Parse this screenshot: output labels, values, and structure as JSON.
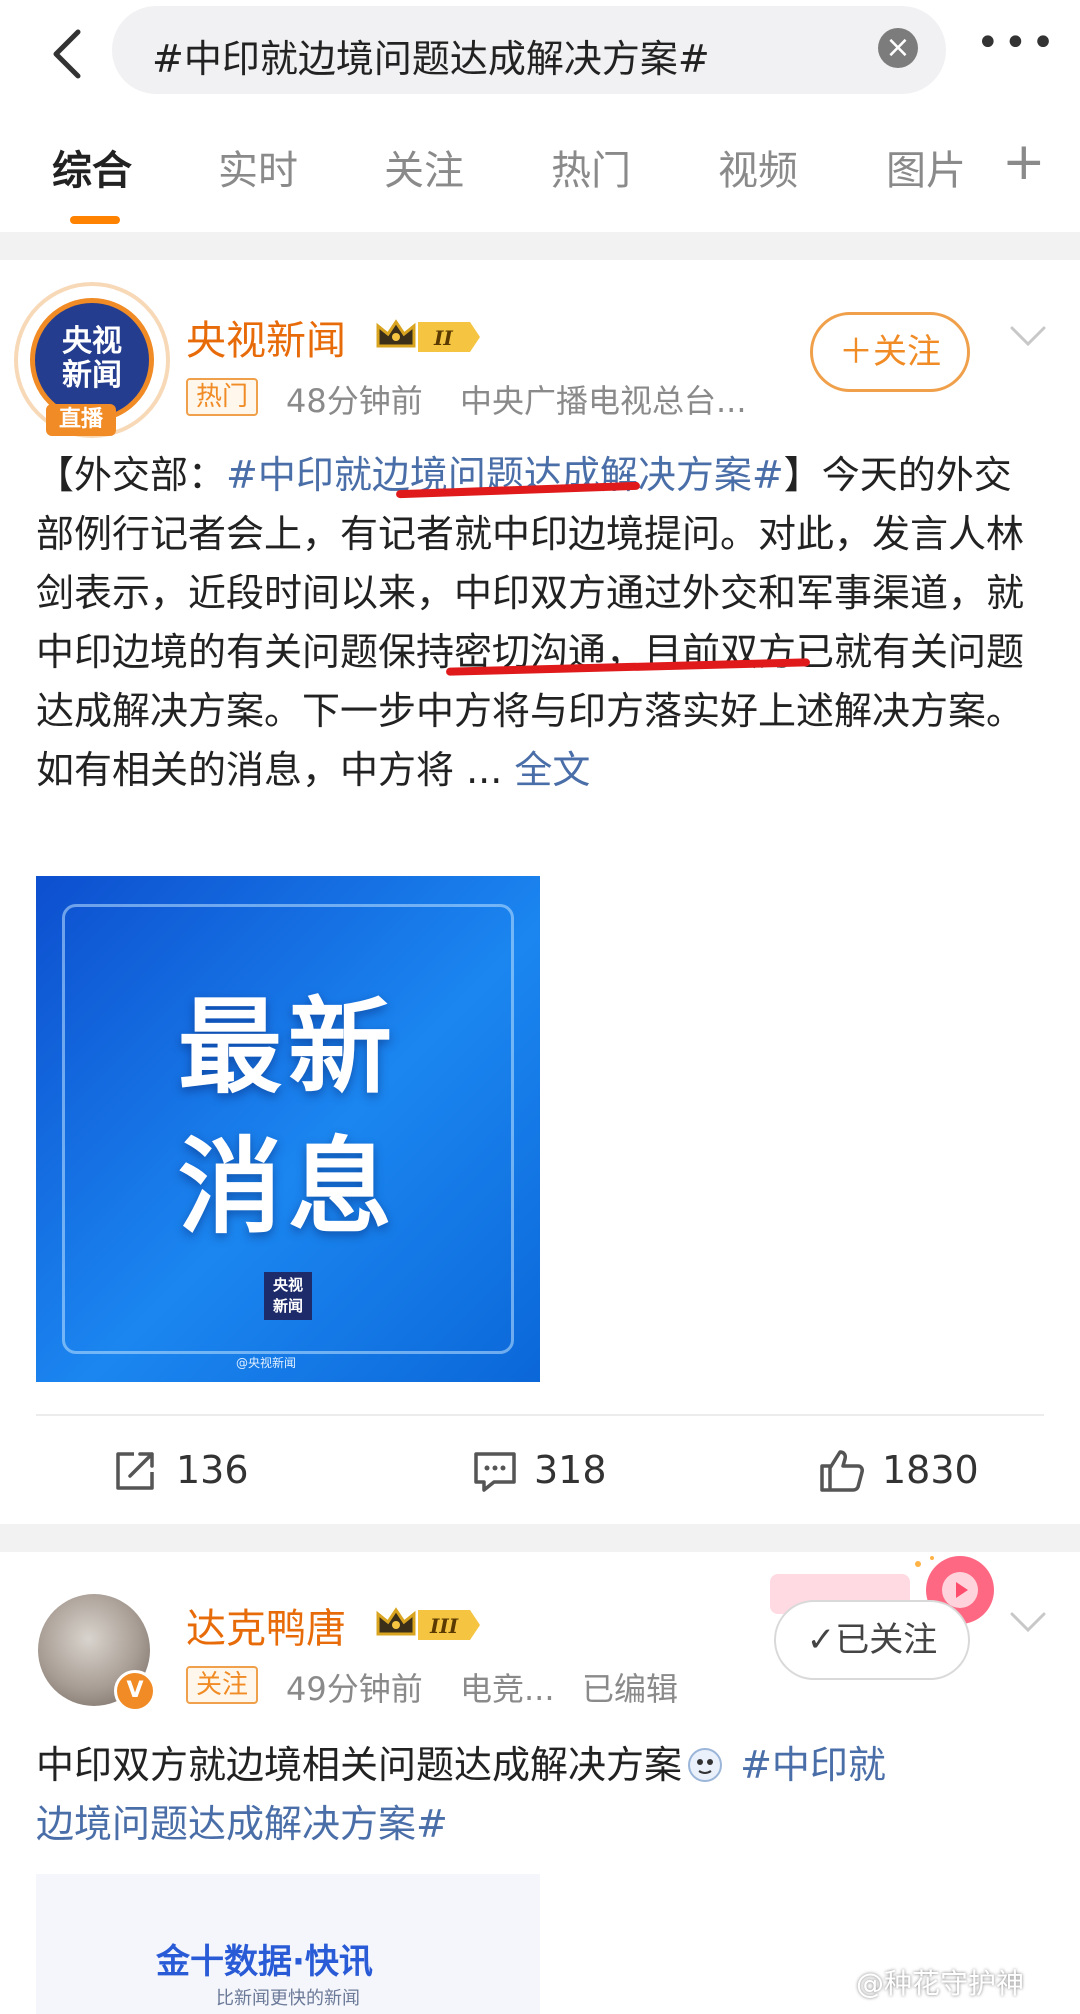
{
  "search": {
    "query": "#中印就边境问题达成解决方案#",
    "clear": "×",
    "more": "•••"
  },
  "tabs": [
    {
      "label": "综合"
    },
    {
      "label": "实时"
    },
    {
      "label": "关注"
    },
    {
      "label": "热门"
    },
    {
      "label": "视频"
    },
    {
      "label": "图片"
    }
  ],
  "tab_add": "+",
  "post1": {
    "author": "央视新闻",
    "avatar_text_top": "央视",
    "avatar_text_bottom": "新闻",
    "avatar_live": "直播",
    "level": "II",
    "tag": "热门",
    "time": "48分钟前",
    "source": "中央广播电视总台...",
    "follow": "＋关注",
    "text_prefix": "【外交部：",
    "topic": "#中印就边境问题达成解决方案#",
    "text_body": "】今天的外交部例行记者会上，有记者就中印边境提问。对此，发言人林剑表示，近段时间以来，中印双方通过外交和军事渠道，就中印边境的有关问题保持密切沟通，目前双方已就有关问题达成解决方案。下一步中方将与印方落实好上述解决方案。如有相关的消息，中方将 ... ",
    "full_text": "全文",
    "image_line1": "最新",
    "image_line2": "消息",
    "image_logo_top": "央视",
    "image_logo_bottom": "新闻",
    "image_credit": "@央视新闻",
    "reposts": "136",
    "comments": "318",
    "likes": "1830"
  },
  "post2": {
    "author": "达克鸭唐",
    "level": "III",
    "tag": "关注",
    "time": "49分钟前",
    "source": "电竞...",
    "edited": "已编辑",
    "followed": "✓已关注",
    "v_badge": "V",
    "text": "中印双方就边境相关问题达成解决方案",
    "topic_part1": " #中印就",
    "topic_part2": "边境问题达成解决方案#",
    "image_brand": "金十数据·快讯",
    "image_sub": "比新闻更快的新闻"
  },
  "watermark": "@种花守护神",
  "colors": {
    "accent": "#ff8200",
    "topic": "#4a6ea8",
    "name": "#e86b0a",
    "annotation": "#e01a1a"
  }
}
